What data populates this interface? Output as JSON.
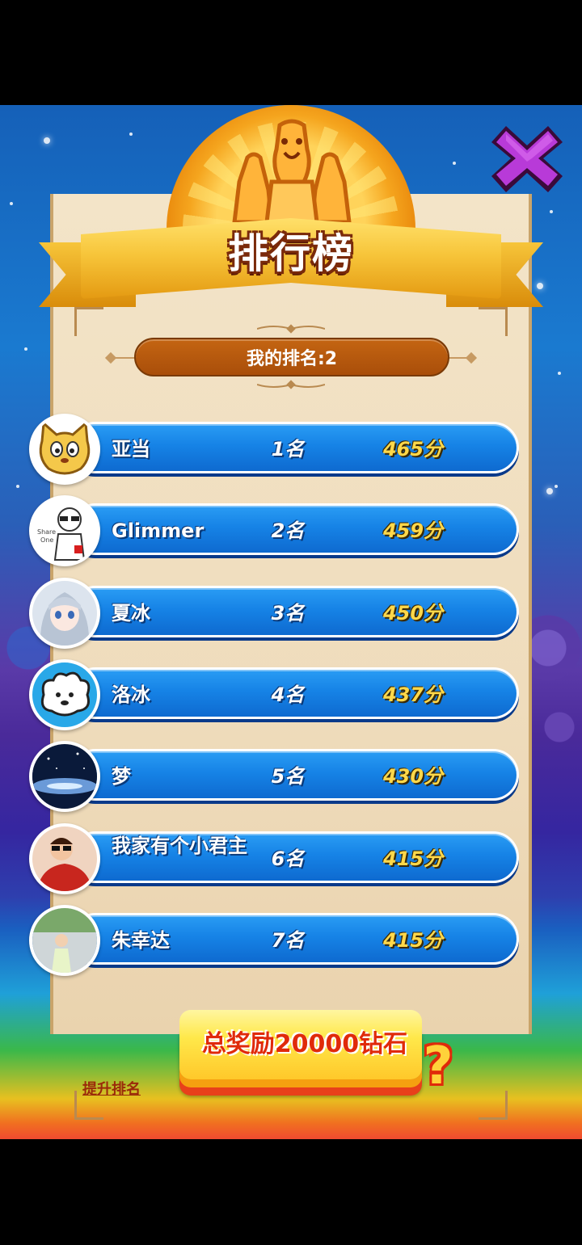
{
  "title": "排行榜",
  "my_rank": "我的排名:2",
  "rankings": [
    {
      "name": "亚当",
      "rank": "1名",
      "score": "465分",
      "avatar": "cat-avatar"
    },
    {
      "name": "Glimmer",
      "rank": "2名",
      "score": "459分",
      "avatar": "glasses-boy-avatar"
    },
    {
      "name": "夏冰",
      "rank": "3名",
      "score": "450分",
      "avatar": "anime-girl-avatar"
    },
    {
      "name": "洛冰",
      "rank": "4名",
      "score": "437分",
      "avatar": "cartoon-sheep-avatar"
    },
    {
      "name": "梦",
      "rank": "5名",
      "score": "430分",
      "avatar": "night-sky-avatar"
    },
    {
      "name": "我家有个小君主",
      "rank": "6名",
      "score": "415分",
      "avatar": "cartoon-man-avatar"
    },
    {
      "name": "朱幸达",
      "rank": "7名",
      "score": "415分",
      "avatar": "child-photo-avatar"
    }
  ],
  "boost_link": "提升排名",
  "reward_button": "总奖励20000钻石",
  "help_icon": "?"
}
